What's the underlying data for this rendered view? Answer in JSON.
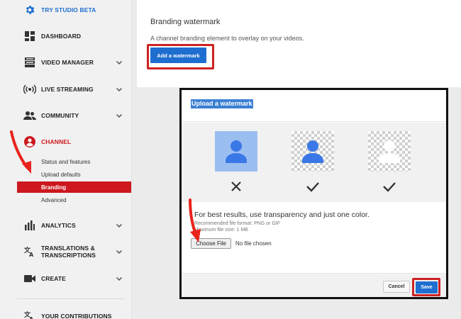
{
  "sidebar": {
    "try_studio": "TRY STUDIO BETA",
    "dashboard": "DASHBOARD",
    "video_manager": "VIDEO MANAGER",
    "live_streaming": "LIVE STREAMING",
    "community": "COMMUNITY",
    "channel": "CHANNEL",
    "channel_sub": [
      "Status and features",
      "Upload defaults",
      "Branding",
      "Advanced"
    ],
    "analytics": "ANALYTICS",
    "translations_line1": "TRANSLATIONS &",
    "translations_line2": "TRANSCRIPTIONS",
    "create": "CREATE",
    "your_contributions": "YOUR CONTRIBUTIONS"
  },
  "branding": {
    "title": "Branding watermark",
    "description": "A channel branding element to overlay on your videos.",
    "add_button": "Add a watermark"
  },
  "modal": {
    "title": "Upload a watermark",
    "previews": [
      {
        "style": "solid-blue-background",
        "verdict": "cross"
      },
      {
        "style": "transparent-background",
        "verdict": "check"
      },
      {
        "style": "transparent-white-icon",
        "verdict": "check"
      }
    ],
    "tip": "For best results, use transparency and just one color.",
    "recommended_format": "Recommended file format: PNG or GIF",
    "max_size": "Maximum file size: 1 MB",
    "choose_file": "Choose File",
    "file_status": "No file chosen",
    "cancel": "Cancel",
    "save": "Save"
  },
  "colors": {
    "accent_red": "#cc181e",
    "primary_blue": "#1e6ed0",
    "annotation_red": "#e8231c",
    "avatar_blue": "#3b78e7"
  }
}
